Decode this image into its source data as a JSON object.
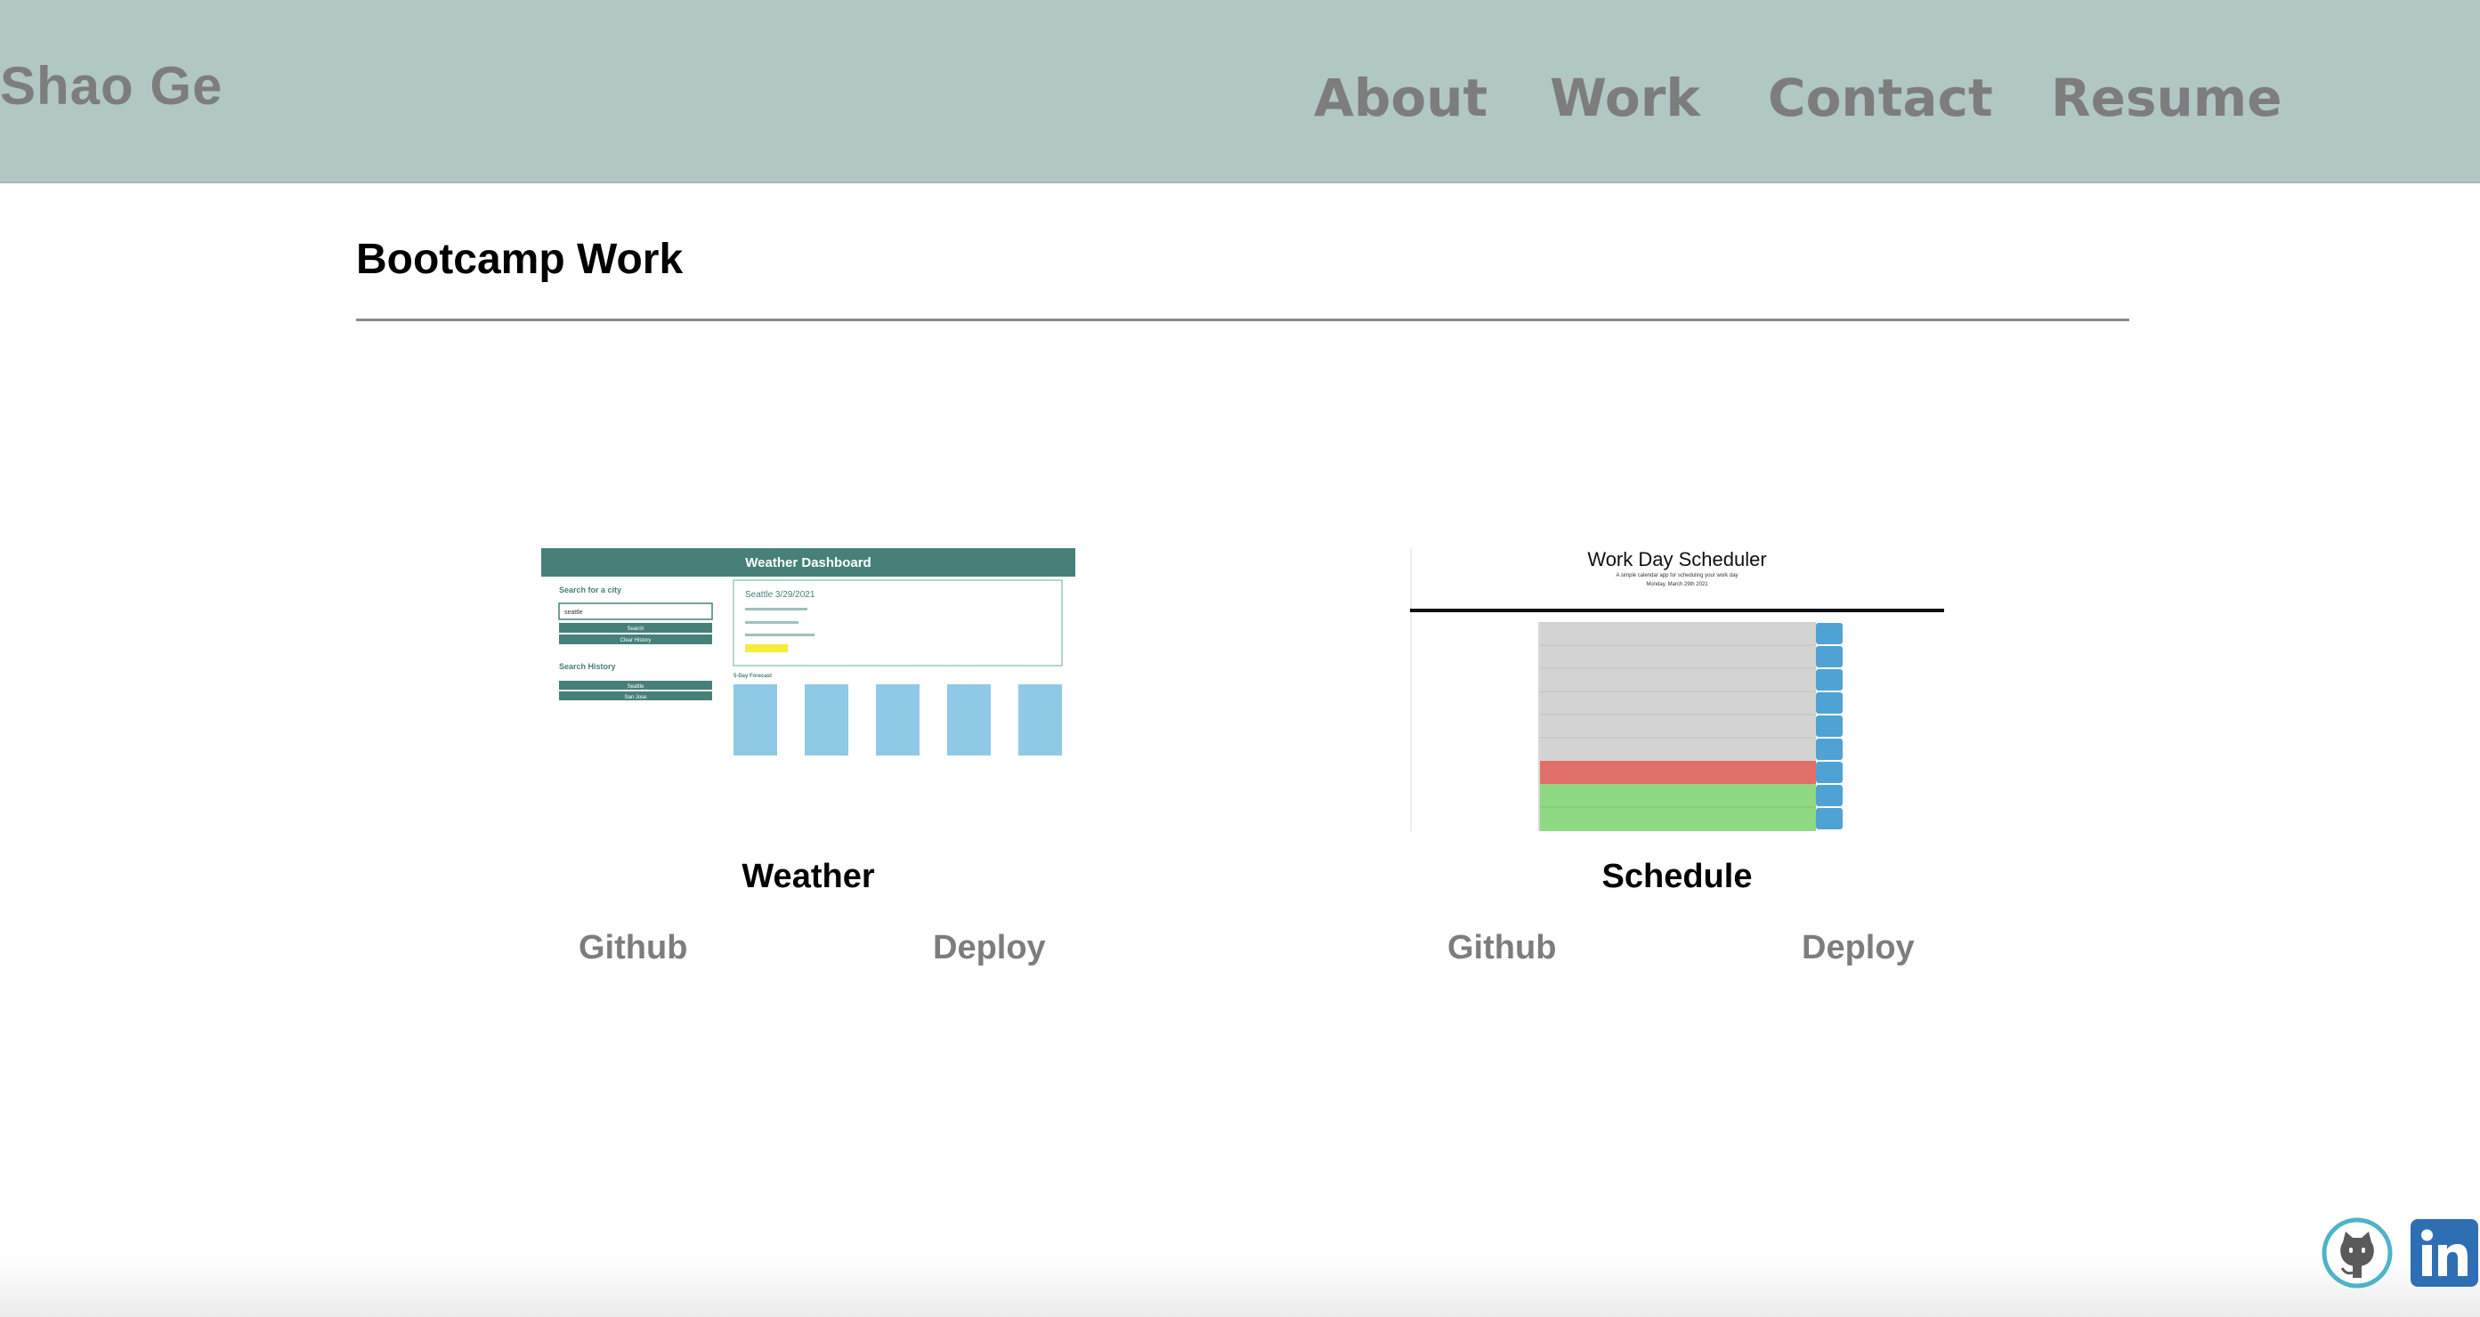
{
  "header": {
    "brand": "Shao Ge",
    "nav": [
      "About",
      "Work",
      "Contact",
      "Resume"
    ]
  },
  "section": {
    "title": "Bootcamp Work"
  },
  "projects": [
    {
      "title": "Weather",
      "links": [
        "Github",
        "Deploy"
      ],
      "thumbnail": {
        "header": "Weather Dashboard",
        "search_label": "Search for a city",
        "input_value": "seattle",
        "search_button": "Search",
        "clear_button": "Clear History",
        "history_label": "Search History",
        "history_items": [
          "Seattle",
          "San Jose"
        ],
        "city_heading": "Seattle 3/29/2021",
        "forecast_label": "5-Day Forecast"
      }
    },
    {
      "title": "Schedule",
      "links": [
        "Github",
        "Deploy"
      ],
      "thumbnail": {
        "header": "Work Day Scheduler",
        "subtitle": "A simple calendar app for scheduling your work day",
        "date": "Monday, March 29th 2021"
      }
    }
  ],
  "colors": {
    "header_bg": "#b1c7c4",
    "nav_text": "#7d7d7d",
    "weather_teal": "#468079",
    "forecast_blue": "#8fc9e6",
    "past_gray": "#d3d3d3",
    "present_red": "#e06f67",
    "future_green": "#8fd884",
    "save_blue": "#4fa3d4"
  },
  "social": [
    "github-icon",
    "linkedin-icon"
  ]
}
